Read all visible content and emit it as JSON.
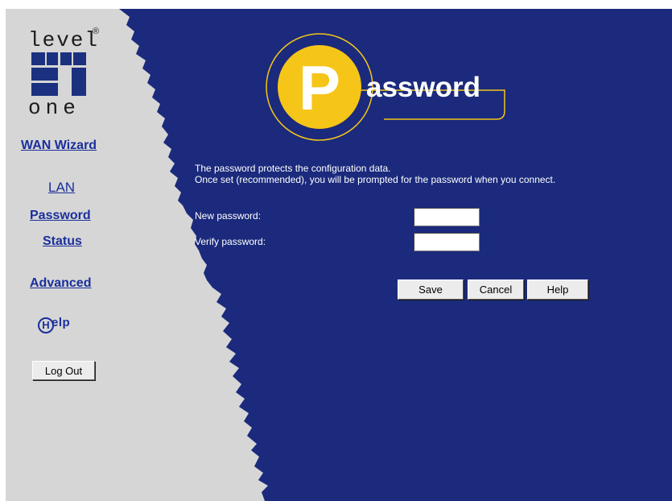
{
  "logo": {
    "word_top": "level",
    "word_bottom": "one",
    "reg_mark": "®"
  },
  "nav": {
    "wan_wizard": "WAN Wizard",
    "lan": "LAN",
    "password": "Password",
    "status": "Status",
    "advanced": "Advanced"
  },
  "help_logo": {
    "letter": "H",
    "text": "elp"
  },
  "logout_label": "Log Out",
  "header": {
    "letter": "P",
    "text": "assword"
  },
  "content": {
    "description_line1": "The password protects the configuration data.",
    "description_line2": "Once set (recommended), you will be prompted for the password when you connect.",
    "new_password_label": "New password:",
    "verify_password_label": "Verify password:",
    "new_password_value": "",
    "verify_password_value": ""
  },
  "buttons": {
    "save": "Save",
    "cancel": "Cancel",
    "help": "Help"
  },
  "colors": {
    "background_blue": "#1b2a7c",
    "sidebar_gray": "#d6d6d6",
    "link_blue": "#1a2f9c",
    "accent_yellow": "#f5c518"
  }
}
